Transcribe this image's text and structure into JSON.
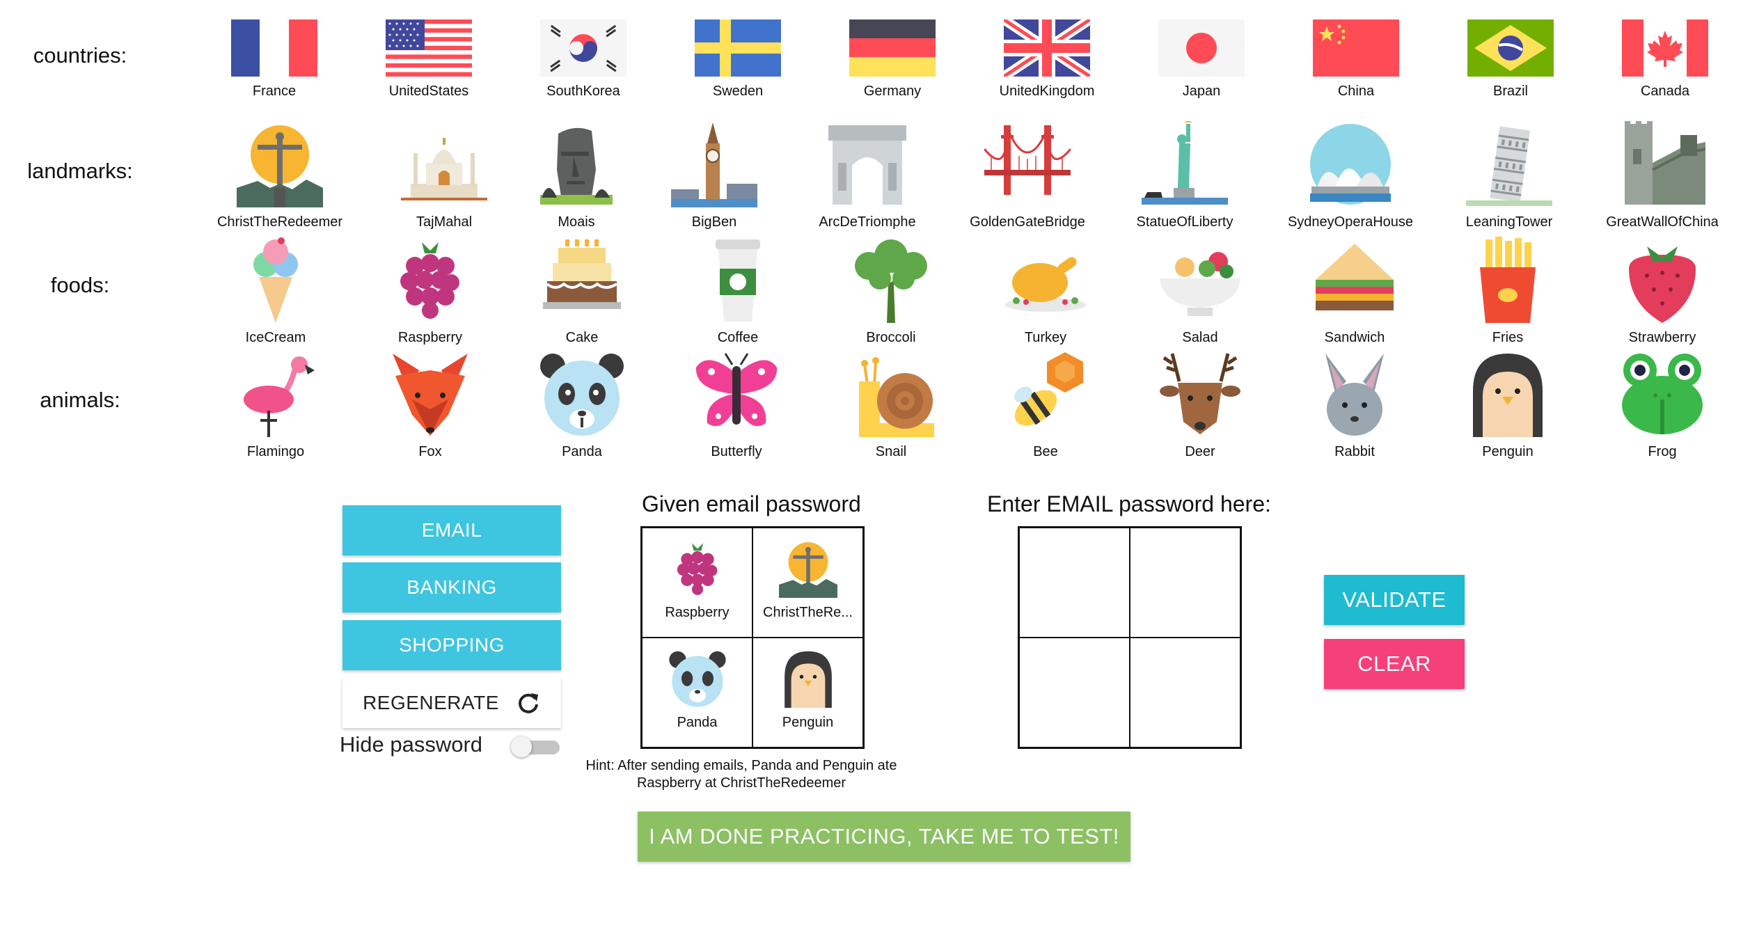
{
  "rows": [
    {
      "label": "countries:",
      "items": [
        "France",
        "UnitedStates",
        "SouthKorea",
        "Sweden",
        "Germany",
        "UnitedKingdom",
        "Japan",
        "China",
        "Brazil",
        "Canada"
      ]
    },
    {
      "label": "landmarks:",
      "items": [
        "ChristTheRedeemer",
        "TajMahal",
        "Moais",
        "BigBen",
        "ArcDeTriomphe",
        "GoldenGateBridge",
        "StatueOfLiberty",
        "SydneyOperaHouse",
        "LeaningTower",
        "GreatWallOfChina"
      ]
    },
    {
      "label": "foods:",
      "items": [
        "IceCream",
        "Raspberry",
        "Cake",
        "Coffee",
        "Broccoli",
        "Turkey",
        "Salad",
        "Sandwich",
        "Fries",
        "Strawberry"
      ]
    },
    {
      "label": "animals:",
      "items": [
        "Flamingo",
        "Fox",
        "Panda",
        "Butterfly",
        "Snail",
        "Bee",
        "Deer",
        "Rabbit",
        "Penguin",
        "Frog"
      ]
    }
  ],
  "buttons": {
    "email": "EMAIL",
    "banking": "BANKING",
    "shopping": "SHOPPING",
    "regenerate": "REGENERATE",
    "validate": "VALIDATE",
    "clear": "CLEAR",
    "done": "I AM DONE PRACTICING, TAKE ME TO TEST!"
  },
  "hide_password": {
    "label": "Hide password",
    "checked": false
  },
  "given": {
    "title": "Given email password",
    "cells": [
      "Raspberry",
      "ChristTheRe...",
      "Panda",
      "Penguin"
    ],
    "hint": "Hint: After sending emails, Panda and Penguin ate Raspberry at ChristTheRedeemer"
  },
  "enter": {
    "title": "Enter EMAIL password here:"
  },
  "colors": {
    "cyan": "#3ec5e0",
    "pink": "#f5407a",
    "validate": "#1ebbd1",
    "green": "#8cc063"
  }
}
